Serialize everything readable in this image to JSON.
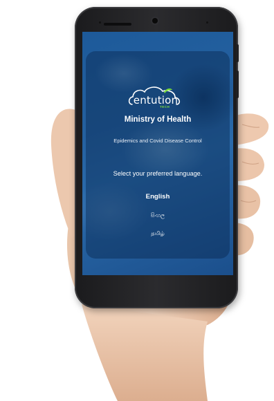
{
  "app": {
    "logo_text": "entution",
    "logo_subtext": "TECH",
    "title": "Ministry of Health",
    "subtitle": "Epidemics and Covid Disease Control",
    "language_prompt": "Select your preferred language."
  },
  "languages": [
    {
      "label": "English"
    },
    {
      "label": "සිංහල"
    },
    {
      "label": "தமிழ்"
    }
  ],
  "colors": {
    "screen_blue": "#24609f",
    "logo_green": "#7ddf3c",
    "text": "#ffffff"
  }
}
